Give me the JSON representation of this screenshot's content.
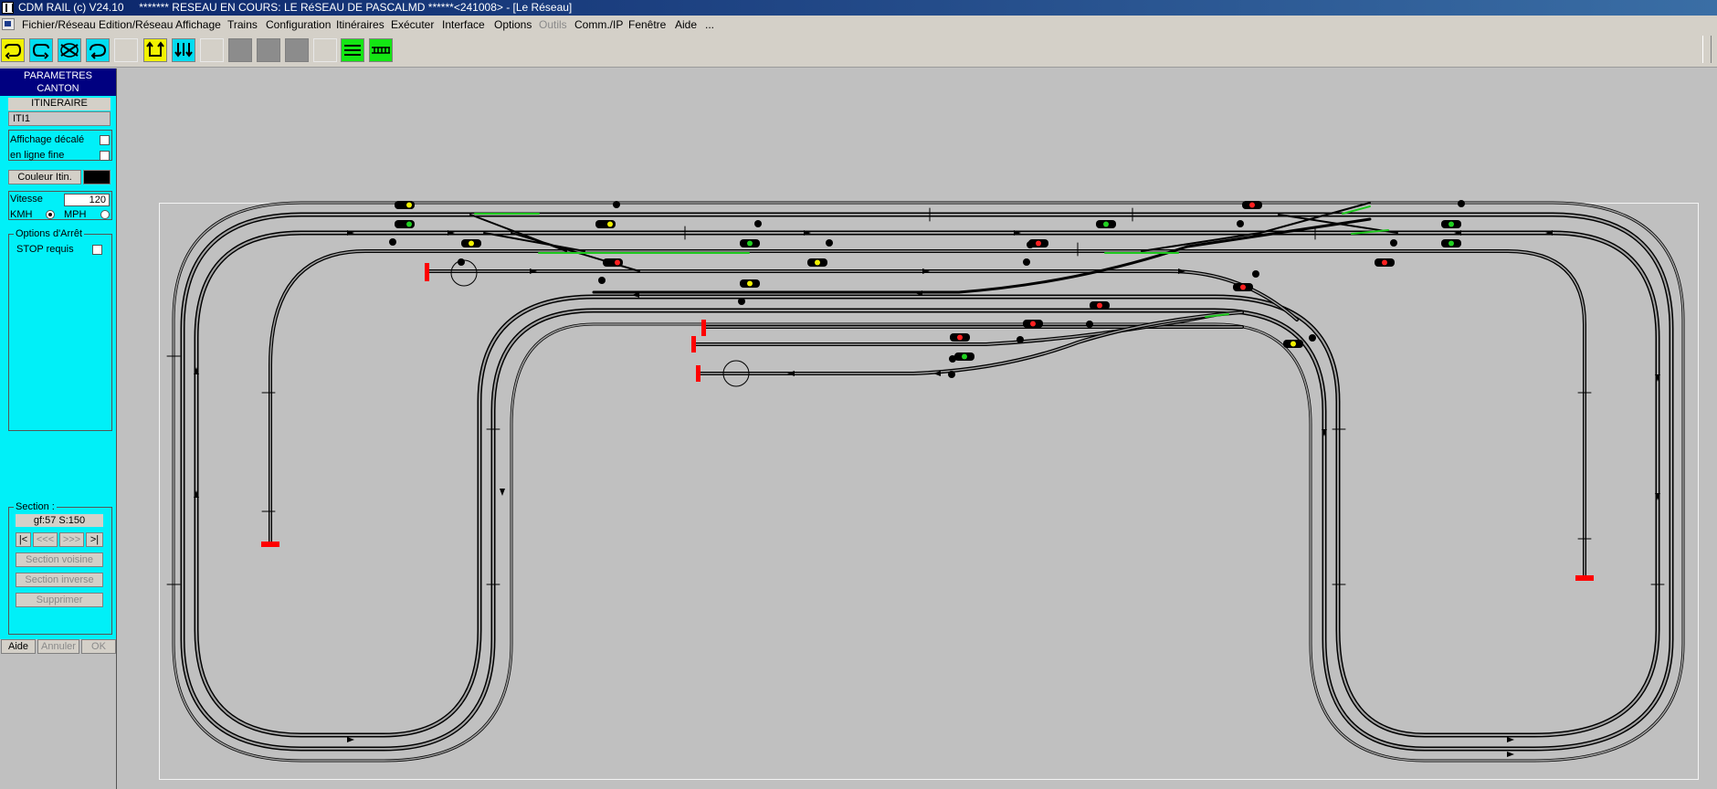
{
  "window": {
    "title": "CDM RAIL (c) V24.10     ******* RESEAU EN COURS: LE RéSEAU DE PASCALMD ******<241008> - [Le Réseau]"
  },
  "menu": [
    {
      "label": "Fichier/Réseau",
      "enabled": true
    },
    {
      "label": "Edition/Réseau",
      "enabled": true
    },
    {
      "label": "Affichage",
      "enabled": true
    },
    {
      "label": "Trains",
      "enabled": true
    },
    {
      "label": "Configuration",
      "enabled": true
    },
    {
      "label": "Itinéraires",
      "enabled": true
    },
    {
      "label": "Exécuter",
      "enabled": true
    },
    {
      "label": "Interface",
      "enabled": true
    },
    {
      "label": "Options",
      "enabled": true
    },
    {
      "label": "Outils",
      "enabled": false
    },
    {
      "label": "Comm./IP",
      "enabled": true
    },
    {
      "label": "Fenêtre",
      "enabled": true
    },
    {
      "label": "Aide",
      "enabled": true
    },
    {
      "label": "...",
      "enabled": true
    }
  ],
  "toolbar_buttons": [
    {
      "icon": "loop-icon",
      "color": "#f2f200"
    },
    {
      "icon": "reverse-loop-icon",
      "color": "#00dcf0"
    },
    {
      "icon": "crossed-loop-icon",
      "color": "#00dcf0"
    },
    {
      "icon": "return-loop-icon",
      "color": "#00dcf0"
    },
    {
      "icon": "blank",
      "color": "#d4d0c8"
    },
    {
      "icon": "route-up-icon",
      "color": "#f2f200"
    },
    {
      "icon": "route-down-icon",
      "color": "#00dcf0"
    },
    {
      "icon": "blank",
      "color": "#d4d0c8"
    },
    {
      "icon": "block-icon",
      "color": "#8c8c8c"
    },
    {
      "icon": "block-icon",
      "color": "#8c8c8c"
    },
    {
      "icon": "block-icon",
      "color": "#8c8c8c"
    },
    {
      "icon": "blank",
      "color": "#d4d0c8"
    },
    {
      "icon": "multi-track-icon",
      "color": "#14e614"
    },
    {
      "icon": "rail-icon",
      "color": "#14e614"
    }
  ],
  "panel": {
    "header_line1": "PARAMETRES",
    "header_line2": "CANTON",
    "itinerary_label": "ITINERAIRE",
    "itinerary_value": "ITI1",
    "shifted_display_label": "Affichage décalé",
    "shifted_display_checked": false,
    "thin_line_label": "en ligne fine",
    "thin_line_checked": false,
    "route_color_button": "Couleur Itin.",
    "route_color": "#000000",
    "speed_label": "Vitesse",
    "speed_value": "120",
    "unit_kmh": "KMH",
    "unit_mph": "MPH",
    "unit_selected": "KMH",
    "stop_options_label": "Options d'Arrêt",
    "stop_required_label": "STOP requis",
    "stop_required_checked": false,
    "section_label": "Section :",
    "section_value": "gf:57 S:150",
    "nav_first": "|<",
    "nav_prev": "<<<",
    "nav_next": ">>>",
    "nav_last": ">|",
    "neighbor_section": "Section voisine",
    "reverse_section": "Section inverse",
    "delete": "Supprimer",
    "help": "Aide",
    "cancel": "Annuler",
    "ok": "OK"
  },
  "layout": {
    "signal_colors": {
      "red": "#ff2020",
      "yellow": "#f0f000",
      "green": "#20d020"
    },
    "track_fill": "#a0a0a0",
    "buffer_color": "#ff0000",
    "route_highlight": "#1ec81e"
  }
}
